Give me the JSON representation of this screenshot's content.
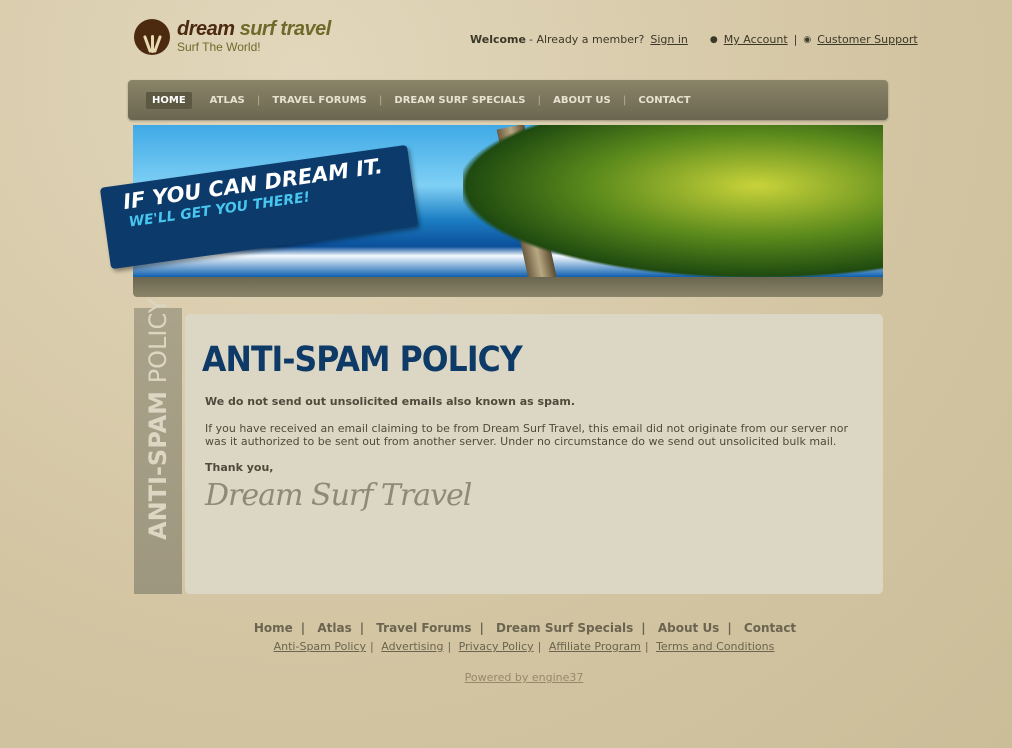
{
  "header": {
    "brand_part1": "dream",
    "brand_part2": "surf travel",
    "tagline": "Surf The World!",
    "welcome": "Welcome",
    "already": "- Already a member?",
    "sign_in": "Sign in",
    "my_account": "My Account",
    "sep": "|",
    "support": "Customer Support"
  },
  "nav": [
    "HOME",
    "ATLAS",
    "TRAVEL FORUMS",
    "DREAM SURF SPECIALS",
    "ABOUT US",
    "CONTACT"
  ],
  "banner": {
    "line1": "IF YOU CAN DREAM IT.",
    "line2": "WE'LL GET YOU THERE!"
  },
  "sidebar": {
    "bold": "ANTI-SPAM",
    "light": " POLICY"
  },
  "content": {
    "title": "ANTI-SPAM POLICY",
    "lead": "We do not send out unsolicited emails also known as spam.",
    "body": "If you have received an email claiming to be from Dream Surf Travel, this email did not originate from our server nor was it authorized to be sent out from another server. Under no circumstance do we send out unsolicited bulk mail.",
    "thanks": "Thank you,",
    "signature": "Dream Surf Travel"
  },
  "footer": {
    "nav": [
      "Home",
      "Atlas",
      "Travel Forums",
      "Dream Surf Specials",
      "About Us",
      "Contact"
    ],
    "links": [
      "Anti-Spam Policy",
      "Advertising",
      "Privacy Policy",
      "Affiliate Program",
      "Terms and Conditions"
    ],
    "powered": "Powered by engine37"
  },
  "colors": {
    "accent": "#0d3a66",
    "nav": "#7a7560"
  }
}
